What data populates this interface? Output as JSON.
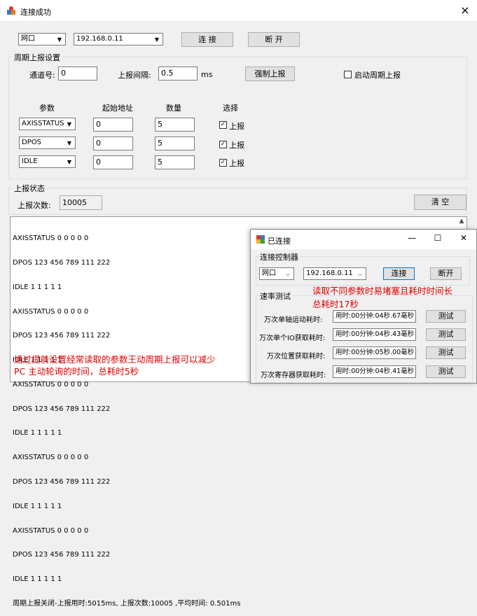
{
  "window": {
    "title": "连接成功",
    "close": "×"
  },
  "connection": {
    "type_value": "网口",
    "ip_value": "192.168.0.11",
    "connect_label": "连 接",
    "disconnect_label": "断 开"
  },
  "periodic": {
    "group_label": "周期上报设置",
    "channel_label": "通道号:",
    "channel_value": "0",
    "interval_label": "上报间隔:",
    "interval_value": "0.5",
    "interval_unit": "ms",
    "force_label": "强制上报",
    "start_label": "启动周期上报",
    "headers": {
      "param": "参数",
      "start": "起始地址",
      "count": "数量",
      "select": "选择"
    },
    "rows": [
      {
        "param": "AXISSTATUS",
        "start": "0",
        "count": "5",
        "select": "上报",
        "checked": true
      },
      {
        "param": "DPOS",
        "start": "0",
        "count": "5",
        "select": "上报",
        "checked": true
      },
      {
        "param": "IDLE",
        "start": "0",
        "count": "5",
        "select": "上报",
        "checked": true
      }
    ]
  },
  "status": {
    "group_label": "上报状态",
    "count_label": "上报次数:",
    "count_value": "10005",
    "clear_label": "清 空"
  },
  "log": {
    "lines": [
      "AXISSTATUS 0 0 0 0 0",
      "DPOS 123 456 789 111 222",
      "IDLE 1 1 1 1 1",
      "AXISSTATUS 0 0 0 0 0",
      "DPOS 123 456 789 111 222",
      "IDLE 1 1 1 1 1",
      "AXISSTATUS 0 0 0 0 0",
      "DPOS 123 456 789 111 222",
      "IDLE 1 1 1 1 1",
      "AXISSTATUS 0 0 0 0 0",
      "DPOS 123 456 789 111 222",
      "IDLE 1 1 1 1 1",
      "AXISSTATUS 0 0 0 0 0",
      "DPOS 123 456 789 111 222",
      "IDLE 1 1 1 1 1",
      "周期上报关闭-上报用时:5015ms, 上报次数:10005 ,平均时间: 0.501ms"
    ],
    "note_line1": "通过提前设置经常读取的参数王动周期上报可以减少",
    "note_line2": "PC 主动轮询的时间，总耗时5秒"
  },
  "sub_window": {
    "title": "已连接",
    "min": "—",
    "max": "☐",
    "close": "✕",
    "connect_group": "连接控制器",
    "type_value": "网口",
    "ip_value": "192.168.0.11",
    "connect_label": "连接",
    "disconnect_label": "断开",
    "rate_group": "速率测试",
    "note_line1": "读取不同参数时易堵塞且耗时时间长",
    "note_line2": "总耗时17秒",
    "tests": [
      {
        "label": "万次单轴运动耗时:",
        "value": "用时:00分钟:04秒.67毫秒",
        "button": "测试"
      },
      {
        "label": "万次单个IO获取耗时:",
        "value": "用时:00分钟:04秒.43毫秒",
        "button": "测试"
      },
      {
        "label": "万次位置获取耗时:",
        "value": "用时:00分钟:05秒.00毫秒",
        "button": "测试"
      },
      {
        "label": "万次寄存器获取耗时:",
        "value": "用时:00分钟:04秒.41毫秒",
        "button": "测试"
      }
    ]
  }
}
